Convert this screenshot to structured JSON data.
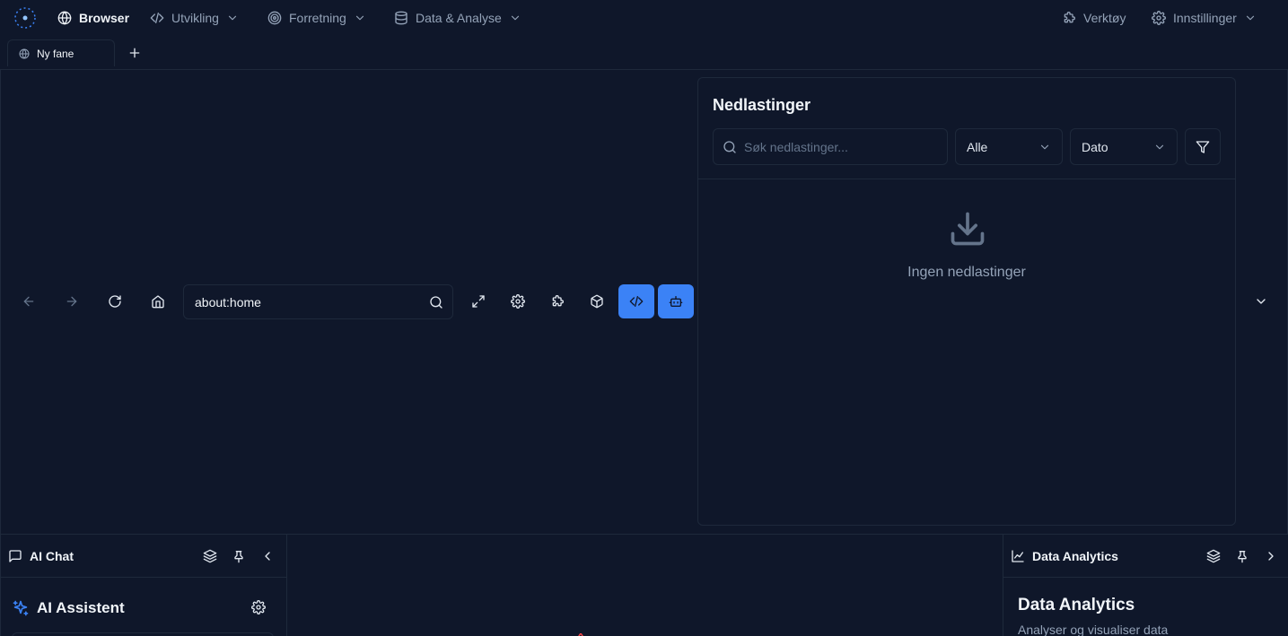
{
  "nav": {
    "items": [
      {
        "label": "Browser",
        "icon": "globe-icon",
        "active": true
      },
      {
        "label": "Utvikling",
        "icon": "code-icon"
      },
      {
        "label": "Forretning",
        "icon": "target-icon"
      },
      {
        "label": "Data & Analyse",
        "icon": "database-icon"
      }
    ],
    "right": [
      {
        "label": "Verktøy",
        "icon": "puzzle-icon"
      },
      {
        "label": "Innstillinger",
        "icon": "gear-icon"
      }
    ]
  },
  "tabs": [
    {
      "label": "Ny fane",
      "icon": "globe-icon"
    }
  ],
  "toolbar": {
    "url": "about:home"
  },
  "downloads": {
    "title": "Nedlastinger",
    "search_placeholder": "Søk nedlastinger...",
    "type_filter": "Alle",
    "sort": "Dato",
    "empty_text": "Ingen nedlastinger"
  },
  "left_panel": {
    "title": "AI Chat",
    "assistant_title": "AI Assistent"
  },
  "right_panel": {
    "title": "Data Analytics",
    "heading": "Data Analytics",
    "subtitle": "Analyser og visualiser data"
  },
  "colors": {
    "background": "#0f172a",
    "accent": "#3b82f6",
    "border": "#1e293b"
  }
}
